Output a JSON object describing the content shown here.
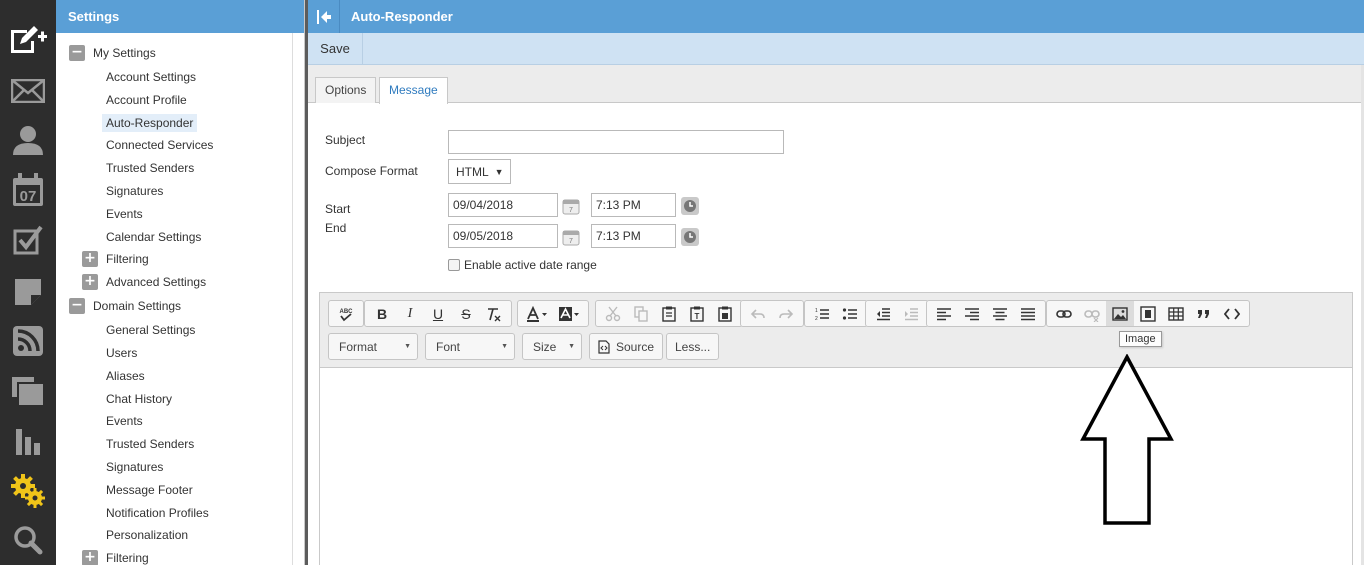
{
  "rail": {
    "items": [
      {
        "name": "compose-icon"
      },
      {
        "name": "mail-icon"
      },
      {
        "name": "contacts-icon"
      },
      {
        "name": "calendar-icon",
        "text": "07"
      },
      {
        "name": "tasks-icon"
      },
      {
        "name": "notes-icon"
      },
      {
        "name": "rss-icon"
      },
      {
        "name": "files-icon"
      },
      {
        "name": "reports-icon"
      },
      {
        "name": "settings-icon"
      },
      {
        "name": "search-icon"
      }
    ],
    "active_color": "#f0c419"
  },
  "sidebar": {
    "title": "Settings",
    "my_settings": {
      "label": "My Settings",
      "toggle": "−",
      "items": [
        "Account Settings",
        "Account Profile",
        "Auto-Responder",
        "Connected Services",
        "Trusted Senders",
        "Signatures",
        "Events",
        "Calendar Settings"
      ],
      "active_item": "Auto-Responder"
    },
    "filtering": {
      "label": "Filtering",
      "toggle": "+"
    },
    "advanced": {
      "label": "Advanced Settings",
      "toggle": "+"
    },
    "domain_settings": {
      "label": "Domain Settings",
      "toggle": "−",
      "items": [
        "General Settings",
        "Users",
        "Aliases",
        "Chat History",
        "Events",
        "Trusted Senders",
        "Signatures",
        "Message Footer",
        "Notification Profiles",
        "Personalization"
      ]
    },
    "domain_filtering": {
      "label": "Filtering",
      "toggle": "+"
    }
  },
  "main": {
    "title": "Auto-Responder",
    "save_label": "Save",
    "tabs": [
      {
        "label": "Options"
      },
      {
        "label": "Message",
        "active": true
      }
    ]
  },
  "form": {
    "subject_label": "Subject",
    "subject_value": "",
    "compose_format_label": "Compose Format",
    "compose_format_value": "HTML",
    "start_label": "Start",
    "end_label": "End",
    "start_date": "09/04/2018",
    "start_time": "7:13 PM",
    "end_date": "09/05/2018",
    "end_time": "7:13 PM",
    "enable_range_label": "Enable active date range",
    "enable_range_checked": false
  },
  "editor": {
    "combos": {
      "format": "Format",
      "font": "Font",
      "size": "Size"
    },
    "source_label": "Source",
    "less_label": "Less...",
    "tooltip": "Image",
    "format_button_labels": {
      "bold": "B",
      "italic": "I",
      "underline": "U",
      "strike": "S"
    }
  },
  "annotation": {
    "arrow_color": "#000000"
  }
}
